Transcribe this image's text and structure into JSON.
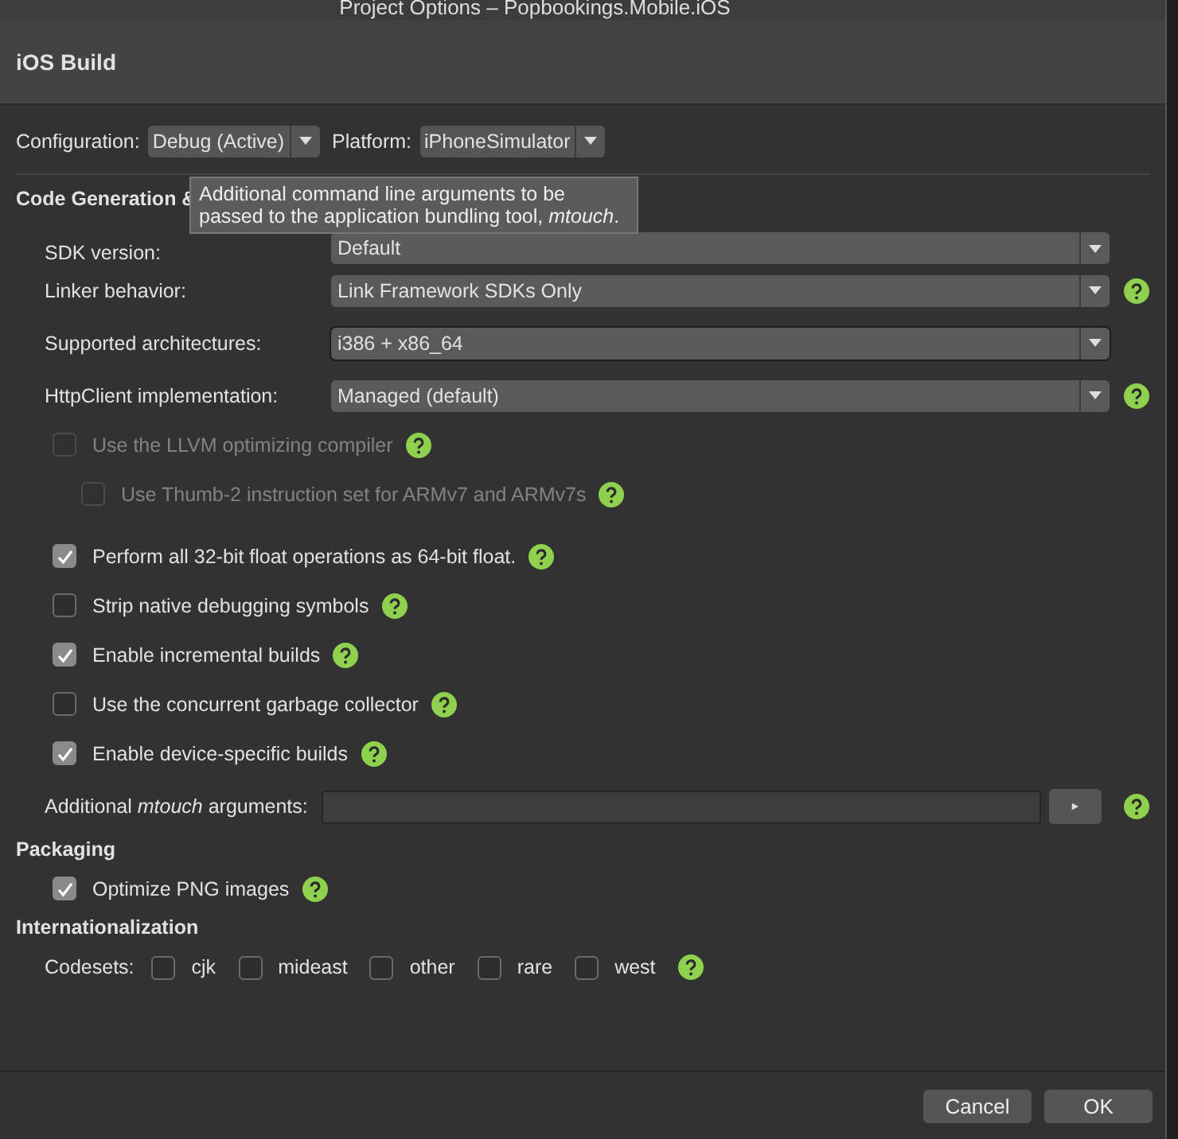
{
  "window": {
    "title": "Project Options – Popbookings.Mobile.iOS"
  },
  "page_title": "iOS Build",
  "configuration": {
    "label": "Configuration:",
    "value": "Debug (Active)"
  },
  "platform": {
    "label": "Platform:",
    "value": "iPhoneSimulator"
  },
  "code_generation": {
    "heading": "Code Generation &",
    "fields": [
      {
        "label": "SDK version:",
        "value": "Default",
        "help": false,
        "focused": false
      },
      {
        "label": "Linker behavior:",
        "value": "Link Framework SDKs Only",
        "help": true,
        "focused": false
      },
      {
        "label": "Supported architectures:",
        "value": "i386 + x86_64",
        "help": false,
        "focused": true
      },
      {
        "label": "HttpClient implementation:",
        "value": "Managed (default)",
        "help": true,
        "focused": false
      }
    ],
    "options": [
      {
        "label": "Use the LLVM optimizing compiler",
        "checked": false,
        "disabled": true,
        "children": [
          {
            "label": "Use Thumb-2 instruction set for ARMv7 and ARMv7s",
            "checked": false,
            "disabled": true
          }
        ]
      },
      {
        "label": "Perform all 32-bit float operations as 64-bit float.",
        "checked": true,
        "disabled": false
      },
      {
        "label": "Strip native debugging symbols",
        "checked": false,
        "disabled": false
      },
      {
        "label": "Enable incremental builds",
        "checked": true,
        "disabled": false
      },
      {
        "label": "Use the concurrent garbage collector",
        "checked": false,
        "disabled": false
      },
      {
        "label": "Enable device-specific builds",
        "checked": true,
        "disabled": false
      }
    ],
    "mtouch": {
      "label": "Additional *mtouch* arguments:",
      "button": "►"
    }
  },
  "packaging": {
    "heading": "Packaging",
    "options": [
      {
        "label": "Optimize PNG images",
        "checked": true
      }
    ]
  },
  "internationalization": {
    "heading": "Internationalization",
    "label": "Codesets:",
    "codesets": [
      {
        "label": "cjk",
        "checked": false
      },
      {
        "label": "mideast",
        "checked": false
      },
      {
        "label": "other",
        "checked": false
      },
      {
        "label": "rare",
        "checked": false
      },
      {
        "label": "west",
        "checked": false
      }
    ]
  },
  "tooltip": "Additional command line arguments to be passed to the application bundling tool, *mtouch*.",
  "buttons": [
    "Cancel",
    "OK"
  ]
}
